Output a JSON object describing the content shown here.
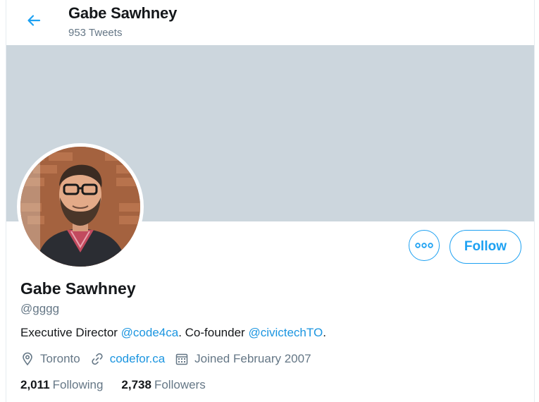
{
  "header": {
    "title": "Gabe Sawhney",
    "subtitle": "953 Tweets",
    "back_icon": "arrow-left-icon"
  },
  "colors": {
    "accent": "#1da1f2",
    "link": "#1b95e0",
    "banner": "#ccd6dd",
    "muted": "#657786",
    "text": "#14171a"
  },
  "profile": {
    "name": "Gabe Sawhney",
    "handle": "@gggg",
    "bio": {
      "prefix": "Executive Director ",
      "mention1": "@code4ca",
      "middle": ". Co-founder ",
      "mention2": "@civictechTO",
      "suffix": "."
    },
    "location": "Toronto",
    "website": "codefor.ca",
    "joined": "Joined February 2007",
    "following_count": "2,011",
    "following_label": "Following",
    "followers_count": "2,738",
    "followers_label": "Followers"
  },
  "actions": {
    "more_icon": "more-dots-icon",
    "follow_label": "Follow"
  }
}
